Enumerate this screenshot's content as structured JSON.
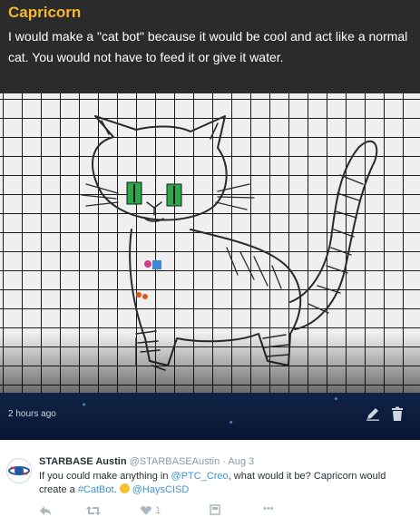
{
  "media_card": {
    "caption": {
      "title": "Capricorn",
      "body": "I would make a \"cat bot\" because it would be cool and act like a normal cat. You would not have to feed it or give it water."
    },
    "timestamp": "2 hours ago",
    "icons": [
      "edit-icon",
      "trash-icon"
    ],
    "accent_color": "#f5b82e"
  },
  "tweet": {
    "author_name": "STARBASE Austin",
    "author_handle": "@STARBASEAustin",
    "separator": "·",
    "date": "Aug 3",
    "text_1": "If you could make anything in ",
    "mention_1": "@PTC_Creo",
    "text_2": ", what would it be? Capricorn would create a ",
    "hashtag": "#CatBot",
    "text_3": ". ",
    "mention_2": "@HaysCISD",
    "actions": {
      "reply_icon": "reply-icon",
      "retweet_icon": "retweet-icon",
      "like_icon": "heart-icon",
      "like_count": "1",
      "share_icon": "share-icon",
      "more_icon": "more-icon",
      "more_glyph": "•••"
    },
    "link_color": "#3b94d9"
  }
}
